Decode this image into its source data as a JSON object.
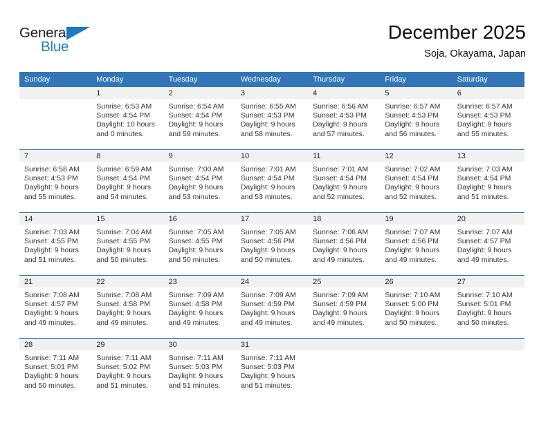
{
  "brand": {
    "name_part1": "General",
    "name_part2": "Blue",
    "triangle_icon": "triangle-logo-icon",
    "colors": {
      "dark": "#231f20",
      "blue": "#2580c3",
      "triangle": "#1e7bc0"
    }
  },
  "header": {
    "title": "December 2025",
    "subtitle": "Soja, Okayama, Japan"
  },
  "theme": {
    "header_blue": "#3276b8",
    "daynum_band": "#f1f1f1",
    "cell_bg": "#ffffff",
    "text": "#333333"
  },
  "weekday_headers": [
    "Sunday",
    "Monday",
    "Tuesday",
    "Wednesday",
    "Thursday",
    "Friday",
    "Saturday"
  ],
  "weeks": [
    {
      "days": [
        {
          "date": "",
          "empty": true,
          "sunrise": "",
          "sunset": "",
          "daylight_line1": "",
          "daylight_line2": ""
        },
        {
          "date": "1",
          "empty": false,
          "sunrise": "Sunrise: 6:53 AM",
          "sunset": "Sunset: 4:54 PM",
          "daylight_line1": "Daylight: 10 hours",
          "daylight_line2": "and 0 minutes."
        },
        {
          "date": "2",
          "empty": false,
          "sunrise": "Sunrise: 6:54 AM",
          "sunset": "Sunset: 4:54 PM",
          "daylight_line1": "Daylight: 9 hours",
          "daylight_line2": "and 59 minutes."
        },
        {
          "date": "3",
          "empty": false,
          "sunrise": "Sunrise: 6:55 AM",
          "sunset": "Sunset: 4:53 PM",
          "daylight_line1": "Daylight: 9 hours",
          "daylight_line2": "and 58 minutes."
        },
        {
          "date": "4",
          "empty": false,
          "sunrise": "Sunrise: 6:56 AM",
          "sunset": "Sunset: 4:53 PM",
          "daylight_line1": "Daylight: 9 hours",
          "daylight_line2": "and 57 minutes."
        },
        {
          "date": "5",
          "empty": false,
          "sunrise": "Sunrise: 6:57 AM",
          "sunset": "Sunset: 4:53 PM",
          "daylight_line1": "Daylight: 9 hours",
          "daylight_line2": "and 56 minutes."
        },
        {
          "date": "6",
          "empty": false,
          "sunrise": "Sunrise: 6:57 AM",
          "sunset": "Sunset: 4:53 PM",
          "daylight_line1": "Daylight: 9 hours",
          "daylight_line2": "and 55 minutes."
        }
      ]
    },
    {
      "days": [
        {
          "date": "7",
          "empty": false,
          "sunrise": "Sunrise: 6:58 AM",
          "sunset": "Sunset: 4:53 PM",
          "daylight_line1": "Daylight: 9 hours",
          "daylight_line2": "and 55 minutes."
        },
        {
          "date": "8",
          "empty": false,
          "sunrise": "Sunrise: 6:59 AM",
          "sunset": "Sunset: 4:54 PM",
          "daylight_line1": "Daylight: 9 hours",
          "daylight_line2": "and 54 minutes."
        },
        {
          "date": "9",
          "empty": false,
          "sunrise": "Sunrise: 7:00 AM",
          "sunset": "Sunset: 4:54 PM",
          "daylight_line1": "Daylight: 9 hours",
          "daylight_line2": "and 53 minutes."
        },
        {
          "date": "10",
          "empty": false,
          "sunrise": "Sunrise: 7:01 AM",
          "sunset": "Sunset: 4:54 PM",
          "daylight_line1": "Daylight: 9 hours",
          "daylight_line2": "and 53 minutes."
        },
        {
          "date": "11",
          "empty": false,
          "sunrise": "Sunrise: 7:01 AM",
          "sunset": "Sunset: 4:54 PM",
          "daylight_line1": "Daylight: 9 hours",
          "daylight_line2": "and 52 minutes."
        },
        {
          "date": "12",
          "empty": false,
          "sunrise": "Sunrise: 7:02 AM",
          "sunset": "Sunset: 4:54 PM",
          "daylight_line1": "Daylight: 9 hours",
          "daylight_line2": "and 52 minutes."
        },
        {
          "date": "13",
          "empty": false,
          "sunrise": "Sunrise: 7:03 AM",
          "sunset": "Sunset: 4:54 PM",
          "daylight_line1": "Daylight: 9 hours",
          "daylight_line2": "and 51 minutes."
        }
      ]
    },
    {
      "days": [
        {
          "date": "14",
          "empty": false,
          "sunrise": "Sunrise: 7:03 AM",
          "sunset": "Sunset: 4:55 PM",
          "daylight_line1": "Daylight: 9 hours",
          "daylight_line2": "and 51 minutes."
        },
        {
          "date": "15",
          "empty": false,
          "sunrise": "Sunrise: 7:04 AM",
          "sunset": "Sunset: 4:55 PM",
          "daylight_line1": "Daylight: 9 hours",
          "daylight_line2": "and 50 minutes."
        },
        {
          "date": "16",
          "empty": false,
          "sunrise": "Sunrise: 7:05 AM",
          "sunset": "Sunset: 4:55 PM",
          "daylight_line1": "Daylight: 9 hours",
          "daylight_line2": "and 50 minutes."
        },
        {
          "date": "17",
          "empty": false,
          "sunrise": "Sunrise: 7:05 AM",
          "sunset": "Sunset: 4:56 PM",
          "daylight_line1": "Daylight: 9 hours",
          "daylight_line2": "and 50 minutes."
        },
        {
          "date": "18",
          "empty": false,
          "sunrise": "Sunrise: 7:06 AM",
          "sunset": "Sunset: 4:56 PM",
          "daylight_line1": "Daylight: 9 hours",
          "daylight_line2": "and 49 minutes."
        },
        {
          "date": "19",
          "empty": false,
          "sunrise": "Sunrise: 7:07 AM",
          "sunset": "Sunset: 4:56 PM",
          "daylight_line1": "Daylight: 9 hours",
          "daylight_line2": "and 49 minutes."
        },
        {
          "date": "20",
          "empty": false,
          "sunrise": "Sunrise: 7:07 AM",
          "sunset": "Sunset: 4:57 PM",
          "daylight_line1": "Daylight: 9 hours",
          "daylight_line2": "and 49 minutes."
        }
      ]
    },
    {
      "days": [
        {
          "date": "21",
          "empty": false,
          "sunrise": "Sunrise: 7:08 AM",
          "sunset": "Sunset: 4:57 PM",
          "daylight_line1": "Daylight: 9 hours",
          "daylight_line2": "and 49 minutes."
        },
        {
          "date": "22",
          "empty": false,
          "sunrise": "Sunrise: 7:08 AM",
          "sunset": "Sunset: 4:58 PM",
          "daylight_line1": "Daylight: 9 hours",
          "daylight_line2": "and 49 minutes."
        },
        {
          "date": "23",
          "empty": false,
          "sunrise": "Sunrise: 7:09 AM",
          "sunset": "Sunset: 4:58 PM",
          "daylight_line1": "Daylight: 9 hours",
          "daylight_line2": "and 49 minutes."
        },
        {
          "date": "24",
          "empty": false,
          "sunrise": "Sunrise: 7:09 AM",
          "sunset": "Sunset: 4:59 PM",
          "daylight_line1": "Daylight: 9 hours",
          "daylight_line2": "and 49 minutes."
        },
        {
          "date": "25",
          "empty": false,
          "sunrise": "Sunrise: 7:09 AM",
          "sunset": "Sunset: 4:59 PM",
          "daylight_line1": "Daylight: 9 hours",
          "daylight_line2": "and 49 minutes."
        },
        {
          "date": "26",
          "empty": false,
          "sunrise": "Sunrise: 7:10 AM",
          "sunset": "Sunset: 5:00 PM",
          "daylight_line1": "Daylight: 9 hours",
          "daylight_line2": "and 50 minutes."
        },
        {
          "date": "27",
          "empty": false,
          "sunrise": "Sunrise: 7:10 AM",
          "sunset": "Sunset: 5:01 PM",
          "daylight_line1": "Daylight: 9 hours",
          "daylight_line2": "and 50 minutes."
        }
      ]
    },
    {
      "days": [
        {
          "date": "28",
          "empty": false,
          "sunrise": "Sunrise: 7:11 AM",
          "sunset": "Sunset: 5:01 PM",
          "daylight_line1": "Daylight: 9 hours",
          "daylight_line2": "and 50 minutes."
        },
        {
          "date": "29",
          "empty": false,
          "sunrise": "Sunrise: 7:11 AM",
          "sunset": "Sunset: 5:02 PM",
          "daylight_line1": "Daylight: 9 hours",
          "daylight_line2": "and 51 minutes."
        },
        {
          "date": "30",
          "empty": false,
          "sunrise": "Sunrise: 7:11 AM",
          "sunset": "Sunset: 5:03 PM",
          "daylight_line1": "Daylight: 9 hours",
          "daylight_line2": "and 51 minutes."
        },
        {
          "date": "31",
          "empty": false,
          "sunrise": "Sunrise: 7:11 AM",
          "sunset": "Sunset: 5:03 PM",
          "daylight_line1": "Daylight: 9 hours",
          "daylight_line2": "and 51 minutes."
        },
        {
          "date": "",
          "empty": true,
          "sunrise": "",
          "sunset": "",
          "daylight_line1": "",
          "daylight_line2": ""
        },
        {
          "date": "",
          "empty": true,
          "sunrise": "",
          "sunset": "",
          "daylight_line1": "",
          "daylight_line2": ""
        },
        {
          "date": "",
          "empty": true,
          "sunrise": "",
          "sunset": "",
          "daylight_line1": "",
          "daylight_line2": ""
        }
      ]
    }
  ]
}
